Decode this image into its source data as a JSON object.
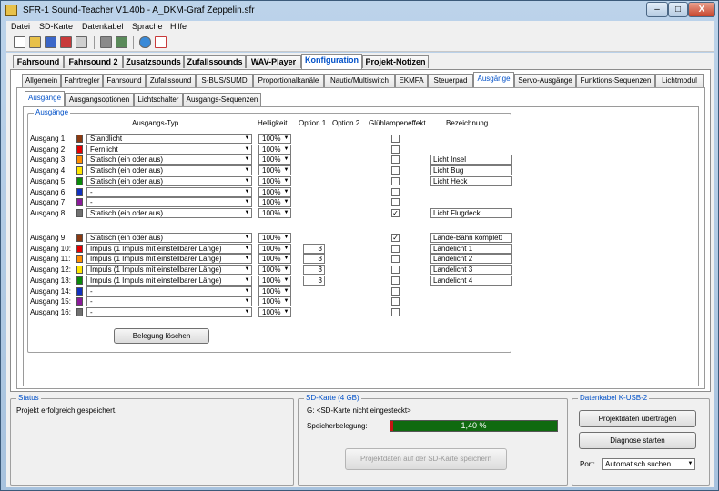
{
  "window": {
    "title": "SFR-1 Sound-Teacher V1.40b - A_DKM-Graf Zeppelin.sfr",
    "minimize": "–",
    "maximize": "□",
    "close": "X"
  },
  "menu": [
    "Datei",
    "SD-Karte",
    "Datenkabel",
    "Sprache",
    "Hilfe"
  ],
  "toolbar_icons": [
    "new-file-icon",
    "open-folder-icon",
    "save-icon",
    "save-as-icon",
    "print-icon",
    "settings-icon",
    "stop-icon",
    "music-note-icon",
    "info-icon"
  ],
  "main_tabs": [
    "Fahrsound",
    "Fahrsound 2",
    "Zusatzsounds",
    "Zufallssounds",
    "WAV-Player",
    "Konfiguration",
    "Projekt-Notizen"
  ],
  "sub_tabs": [
    "Allgemein",
    "Fahrtregler",
    "Fahrsound",
    "Zufallssound",
    "S-BUS/SUMD",
    "Proportionalkanäle",
    "Nautic/Multiswitch",
    "EKMFA",
    "Steuerpad",
    "Ausgänge",
    "Servo-Ausgänge",
    "Funktions-Sequenzen",
    "Lichtmodul"
  ],
  "inner_tabs": [
    "Ausgänge",
    "Ausgangsoptionen",
    "Lichtschalter",
    "Ausgangs-Sequenzen"
  ],
  "group_title": "Ausgänge",
  "headers": {
    "typ": "Ausgangs-Typ",
    "helligkeit": "Helligkeit",
    "opt1": "Option 1",
    "opt2": "Option 2",
    "gluehlampe": "Glühlampeneffekt",
    "bezeichnung": "Bezeichnung"
  },
  "outputs": [
    {
      "label": "Ausgang 1:",
      "color": "#8b3a12",
      "typ": "Standlicht",
      "helligkeit": "100%",
      "option1": "",
      "gluehlampe": false,
      "bezeichnung": ""
    },
    {
      "label": "Ausgang 2:",
      "color": "#e60000",
      "typ": "Fernlicht",
      "helligkeit": "100%",
      "option1": "",
      "gluehlampe": false,
      "bezeichnung": ""
    },
    {
      "label": "Ausgang 3:",
      "color": "#ff8c00",
      "typ": "Statisch (ein oder aus)",
      "helligkeit": "100%",
      "option1": "",
      "gluehlampe": false,
      "bezeichnung": "Licht Insel"
    },
    {
      "label": "Ausgang 4:",
      "color": "#ffe600",
      "typ": "Statisch (ein oder aus)",
      "helligkeit": "100%",
      "option1": "",
      "gluehlampe": false,
      "bezeichnung": "Licht Bug"
    },
    {
      "label": "Ausgang 5:",
      "color": "#0a8a0a",
      "typ": "Statisch (ein oder aus)",
      "helligkeit": "100%",
      "option1": "",
      "gluehlampe": false,
      "bezeichnung": "Licht Heck"
    },
    {
      "label": "Ausgang 6:",
      "color": "#1030c0",
      "typ": "-",
      "helligkeit": "100%",
      "option1": "",
      "gluehlampe": false,
      "bezeichnung": ""
    },
    {
      "label": "Ausgang 7:",
      "color": "#8a1a9a",
      "typ": "-",
      "helligkeit": "100%",
      "option1": "",
      "gluehlampe": false,
      "bezeichnung": ""
    },
    {
      "label": "Ausgang 8:",
      "color": "#707070",
      "typ": "Statisch (ein oder aus)",
      "helligkeit": "100%",
      "option1": "",
      "gluehlampe": true,
      "bezeichnung": "Licht Flugdeck"
    },
    {
      "label": "Ausgang 9:",
      "color": "#8b3a12",
      "typ": "Statisch (ein oder aus)",
      "helligkeit": "100%",
      "option1": "",
      "gluehlampe": true,
      "bezeichnung": "Lande-Bahn komplett"
    },
    {
      "label": "Ausgang 10:",
      "color": "#e60000",
      "typ": "Impuls (1 Impuls mit einstellbarer Länge)",
      "helligkeit": "100%",
      "option1": "3",
      "gluehlampe": false,
      "bezeichnung": "Landelicht 1"
    },
    {
      "label": "Ausgang 11:",
      "color": "#ff8c00",
      "typ": "Impuls (1 Impuls mit einstellbarer Länge)",
      "helligkeit": "100%",
      "option1": "3",
      "gluehlampe": false,
      "bezeichnung": "Landelicht 2"
    },
    {
      "label": "Ausgang 12:",
      "color": "#ffe600",
      "typ": "Impuls (1 Impuls mit einstellbarer Länge)",
      "helligkeit": "100%",
      "option1": "3",
      "gluehlampe": false,
      "bezeichnung": "Landelicht 3"
    },
    {
      "label": "Ausgang 13:",
      "color": "#0a8a0a",
      "typ": "Impuls (1 Impuls mit einstellbarer Länge)",
      "helligkeit": "100%",
      "option1": "3",
      "gluehlampe": false,
      "bezeichnung": "Landelicht 4"
    },
    {
      "label": "Ausgang 14:",
      "color": "#1030c0",
      "typ": "-",
      "helligkeit": "100%",
      "option1": "",
      "gluehlampe": false,
      "bezeichnung": ""
    },
    {
      "label": "Ausgang 15:",
      "color": "#8a1a9a",
      "typ": "-",
      "helligkeit": "100%",
      "option1": "",
      "gluehlampe": false,
      "bezeichnung": ""
    },
    {
      "label": "Ausgang 16:",
      "color": "#707070",
      "typ": "-",
      "helligkeit": "100%",
      "option1": "",
      "gluehlampe": false,
      "bezeichnung": ""
    }
  ],
  "clear_button": "Belegung löschen",
  "status": {
    "title": "Status",
    "text": "Projekt erfolgreich gespeichert."
  },
  "sd": {
    "title": "SD-Karte (4 GB)",
    "drive": "G: <SD-Karte nicht eingesteckt>",
    "usage_label": "Speicherbelegung:",
    "usage_text": "1,40 %",
    "usage_fraction": 0.014,
    "save_button": "Projektdaten auf der SD-Karte speichern"
  },
  "cable": {
    "title": "Datenkabel K-USB-2",
    "transfer_button": "Projektdaten übertragen",
    "diagnose_button": "Diagnose starten",
    "port_label": "Port:",
    "port_value": "Automatisch suchen"
  }
}
